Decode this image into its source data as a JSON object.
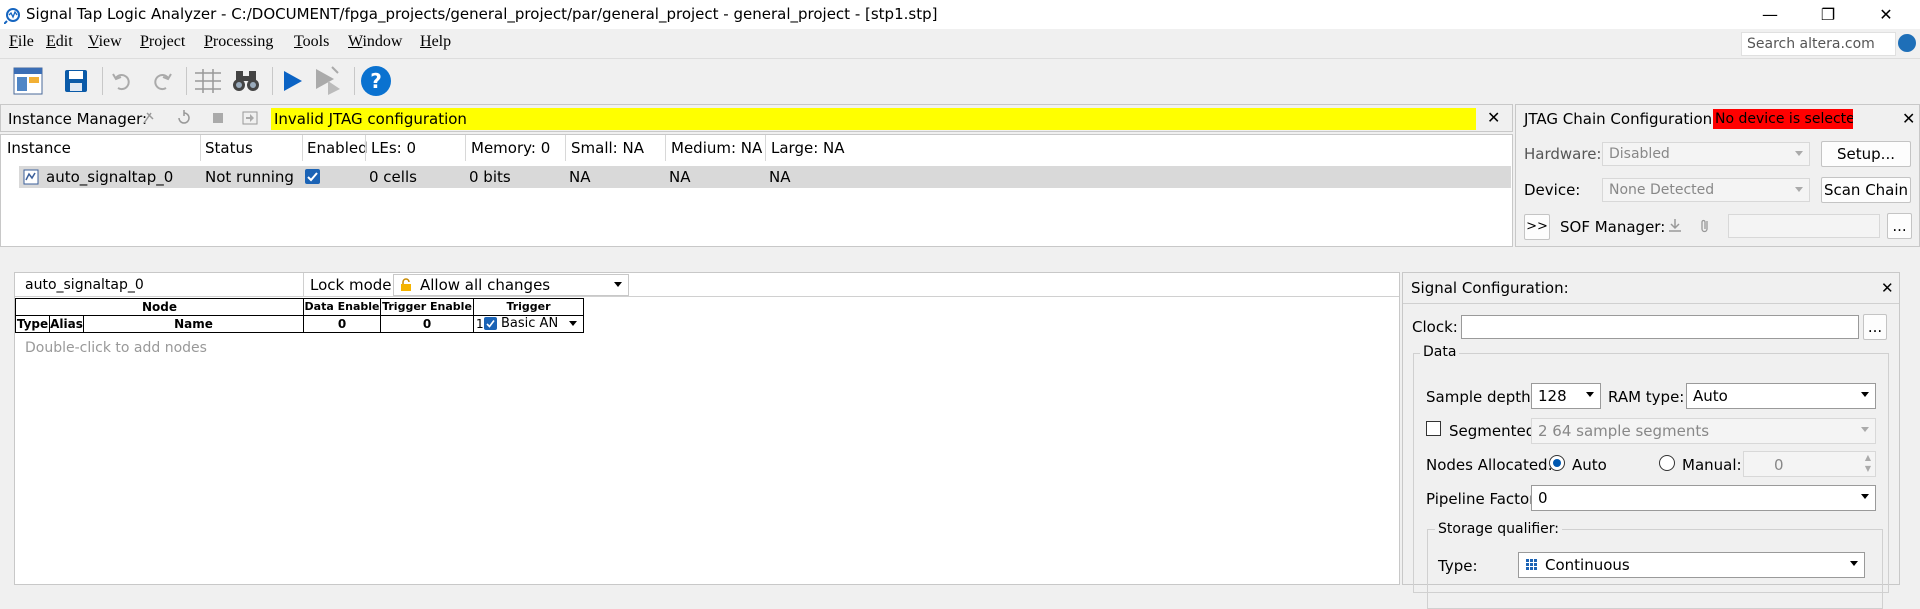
{
  "window": {
    "title": "Signal Tap Logic Analyzer - C:/DOCUMENT/fpga_projects/general_project/par/general_project - general_project - [stp1.stp]",
    "minimize": "—",
    "restore": "❐",
    "close": "✕"
  },
  "menu": {
    "items": [
      "File",
      "Edit",
      "View",
      "Project",
      "Processing",
      "Tools",
      "Window",
      "Help"
    ],
    "search_placeholder": "Search altera.com"
  },
  "instance_manager": {
    "label": "Instance Manager:",
    "message": "Invalid JTAG configuration",
    "close": "✕",
    "columns": [
      "Instance",
      "Status",
      "Enabled",
      "LEs: 0",
      "Memory: 0",
      "Small: NA",
      "Medium: NA",
      "Large: NA"
    ],
    "row": {
      "instance": "auto_signaltap_0",
      "status": "Not running",
      "enabled": true,
      "les": "0 cells",
      "memory": "0 bits",
      "small": "NA",
      "medium": "NA",
      "large": "NA"
    }
  },
  "jtag": {
    "title": "JTAG Chain Configuration:",
    "status": "No device is selected",
    "close": "✕",
    "hardware_label": "Hardware:",
    "hardware_value": "Disabled",
    "setup_button": "Setup...",
    "device_label": "Device:",
    "device_value": "None Detected",
    "scan_button": "Scan Chain",
    "expand_button": ">>",
    "sof_label": "SOF Manager:",
    "browse_button": "..."
  },
  "node_panel": {
    "instance_name": "auto_signaltap_0",
    "lock_label": "Lock mode:",
    "lock_value": "Allow all changes",
    "headers": {
      "node": "Node",
      "data_enable": "Data Enable",
      "trigger_enable": "Trigger Enable",
      "trigger_conditions": "Trigger Conditions",
      "type": "Type",
      "alias": "Alias",
      "name": "Name",
      "data_enable_count": "0",
      "trigger_enable_count": "0",
      "trigger_condition_index": "1",
      "trigger_condition_value": "Basic AN"
    },
    "hint": "Double-click to add nodes"
  },
  "signal_config": {
    "title": "Signal Configuration:",
    "close": "✕",
    "clock_label": "Clock:",
    "clock_value": "",
    "clock_browse": "...",
    "data_group": "Data",
    "sample_depth_label": "Sample depth:",
    "sample_depth_value": "128",
    "ram_type_label": "RAM type:",
    "ram_type_value": "Auto",
    "segmented_label": "Segmented:",
    "segmented_checked": false,
    "segmented_value": "2  64 sample segments",
    "nodes_allocated_label": "Nodes Allocated:",
    "nodes_auto_label": "Auto",
    "nodes_manual_label": "Manual:",
    "nodes_manual_value": "0",
    "pipeline_label": "Pipeline Factor:",
    "pipeline_value": "0",
    "storage_group": "Storage qualifier:",
    "storage_type_label": "Type:",
    "storage_type_value": "Continuous"
  }
}
